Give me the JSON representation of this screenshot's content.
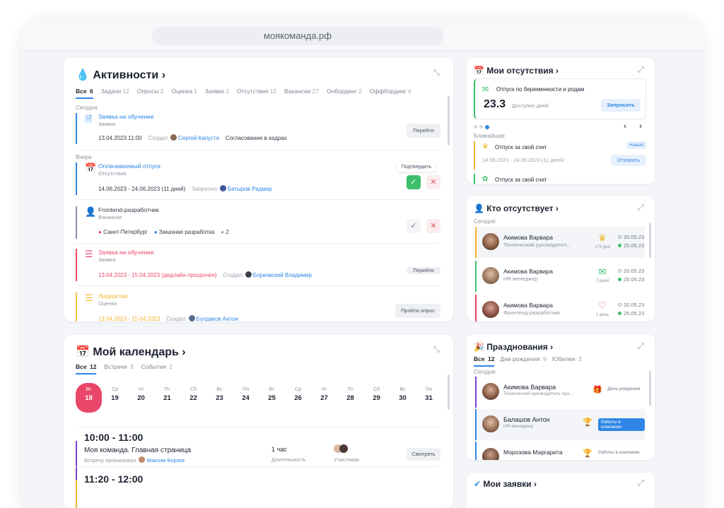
{
  "browser": {
    "url": "моякоманда.рф"
  },
  "activities": {
    "title": "Активности",
    "tabs": [
      {
        "label": "Все",
        "count": "6"
      },
      {
        "label": "Задачи",
        "count": "12"
      },
      {
        "label": "Опросы",
        "count": "2"
      },
      {
        "label": "Оценка",
        "count": "1"
      },
      {
        "label": "Заявки",
        "count": "3"
      },
      {
        "label": "Отсутствия",
        "count": "12"
      },
      {
        "label": "Вакансии",
        "count": "27"
      },
      {
        "label": "Онбординг",
        "count": "2"
      },
      {
        "label": "Оффбординг",
        "count": "4"
      }
    ],
    "today_label": "Сегодня",
    "yesterday_label": "Вчера",
    "items": [
      {
        "title": "Заявка на обучение",
        "type": "Заявки",
        "date": "13.04.2023 11:00",
        "person_label": "Создал",
        "person": "Сергей Капуста",
        "status": "Согласование в кадрах",
        "button": "Перейти"
      },
      {
        "title": "Оплачиваемый отпуск",
        "type": "Отсутствия",
        "date": "14.06.2023 - 24.06.2023 (11 дней)",
        "person_label": "Запросил",
        "person": "Батыров Радмир",
        "tooltip": "Подтвердить"
      },
      {
        "title": "Frontend-разработчик",
        "type": "Вакансии",
        "city": "Санкт-Петербург",
        "kind": "Заказная разработка",
        "count": "2"
      },
      {
        "title": "Заявка на обучение",
        "type": "Заявка",
        "date": "13.04.2023 - 15.04.2023 (дедлайн просрочен)",
        "person_label": "Создал",
        "person": "Борковский Владимир",
        "button": "Перейти"
      },
      {
        "title": "Лидерство",
        "type": "Оценка",
        "date": "13.04.2023 - 15.04.2023",
        "person_label": "Создал",
        "person": "Булдаков Антон",
        "button": "Пройти опрос"
      }
    ]
  },
  "calendar": {
    "title": "Мой календарь",
    "tabs": [
      {
        "label": "Все",
        "count": "12"
      },
      {
        "label": "Встречи",
        "count": "3"
      },
      {
        "label": "События",
        "count": "2"
      }
    ],
    "days": [
      {
        "wd": "Вт",
        "d": "18"
      },
      {
        "wd": "Ср",
        "d": "19"
      },
      {
        "wd": "Чт",
        "d": "20"
      },
      {
        "wd": "Пт",
        "d": "21"
      },
      {
        "wd": "Сб",
        "d": "22"
      },
      {
        "wd": "Вс",
        "d": "23"
      },
      {
        "wd": "Пн",
        "d": "24"
      },
      {
        "wd": "Вт",
        "d": "25"
      },
      {
        "wd": "Ср",
        "d": "26"
      },
      {
        "wd": "Чт",
        "d": "27"
      },
      {
        "wd": "Пт",
        "d": "28"
      },
      {
        "wd": "Сб",
        "d": "29"
      },
      {
        "wd": "Вс",
        "d": "30"
      },
      {
        "wd": "Пн",
        "d": "31"
      }
    ],
    "events": [
      {
        "time": "10:00 - 11:00",
        "title": "Моя команда. Главная страница",
        "meta": "Встречу организовал",
        "person": "Максим Борзов",
        "duration": "1 час",
        "duration_label": "Длительность",
        "participants_label": "Участники",
        "button": "Смотреть"
      },
      {
        "time": "11:20 - 12:00"
      }
    ]
  },
  "absences": {
    "title": "Мои отсутствия",
    "card_title": "Отпуск по беременности и родам",
    "days_value": "23.3",
    "days_label": "Доступно дней",
    "request_button": "Запросить",
    "upcoming_label": "Ближайшие",
    "upcoming": [
      {
        "title": "Отпуск за свой счет",
        "badge": "Новый",
        "date": "14.06.2023 - 24.06.2023 (11 дней)",
        "button": "Отозвать"
      },
      {
        "title": "Отпуск за свой счет"
      }
    ]
  },
  "who_absent": {
    "title": "Кто отсутствует",
    "today_label": "Сегодня",
    "rows": [
      {
        "name": "Акимова Варвара",
        "role": "Технический руководител...",
        "days": "174 дня",
        "from": "20.05.23",
        "to": "25.05.23",
        "color": "#f1b52e"
      },
      {
        "name": "Акимова Варвара",
        "role": "HR-менеджер",
        "days": "7 дней",
        "from": "20.05.23",
        "to": "25.05.23",
        "color": "#3bbf6a"
      },
      {
        "name": "Акимова Варвара",
        "role": "Фронтенд-разработчик",
        "days": "1 день",
        "from": "20.05.23",
        "to": "25.05.23",
        "color": "#e9476a"
      }
    ]
  },
  "celebrations": {
    "title": "Празднования",
    "tabs": [
      {
        "label": "Все",
        "count": "12"
      },
      {
        "label": "Дни рождения",
        "count": "9"
      },
      {
        "label": "Юбилеи",
        "count": "3"
      }
    ],
    "today_label": "Сегодня",
    "rows": [
      {
        "name": "Акимова Варвара",
        "role": "Технический руководитель про...",
        "badge": "День рождения"
      },
      {
        "name": "Балашов Антон",
        "role": "HR-менеджер",
        "badge": "Работы в компании"
      },
      {
        "name": "Морозова Маргарита",
        "role": "",
        "badge": "Работы в компании"
      }
    ]
  },
  "requests": {
    "title": "Мои заявки"
  }
}
